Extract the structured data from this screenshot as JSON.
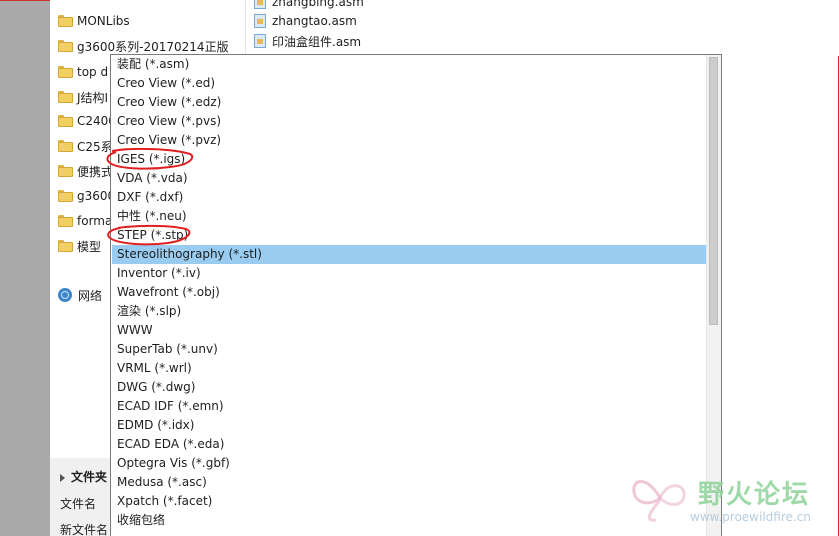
{
  "nav_pane": {
    "folders": [
      {
        "label": "MONLibs"
      },
      {
        "label": "g3600系列-20170214正版"
      },
      {
        "label": "top d"
      },
      {
        "label": "J结构I"
      },
      {
        "label": "C2400"
      },
      {
        "label": "C25系"
      },
      {
        "label": "便携式"
      },
      {
        "label": "g3600"
      },
      {
        "label": "forma"
      },
      {
        "label": "模型"
      }
    ],
    "network": {
      "label": "网络"
    }
  },
  "file_list": {
    "items": [
      {
        "name": "zhangbing.asm"
      },
      {
        "name": "zhangtao.asm"
      },
      {
        "name": "印油盒组件.asm"
      }
    ]
  },
  "bottom_form": {
    "folder_toggle_label": "文件夹",
    "file_name_label": "文件名",
    "new_file_name_label": "新文件名"
  },
  "type_dropdown": {
    "items": [
      {
        "label": "装配 (*.asm)"
      },
      {
        "label": "Creo View (*.ed)"
      },
      {
        "label": "Creo View (*.edz)"
      },
      {
        "label": "Creo View (*.pvs)"
      },
      {
        "label": "Creo View (*.pvz)"
      },
      {
        "label": "IGES (*.igs)"
      },
      {
        "label": "VDA (*.vda)"
      },
      {
        "label": "DXF (*.dxf)"
      },
      {
        "label": "中性 (*.neu)"
      },
      {
        "label": "STEP (*.stp)"
      },
      {
        "label": "Stereolithography (*.stl)"
      },
      {
        "label": "Inventor (*.iv)"
      },
      {
        "label": "Wavefront (*.obj)"
      },
      {
        "label": "渲染 (*.slp)"
      },
      {
        "label": "WWW"
      },
      {
        "label": "SuperTab (*.unv)"
      },
      {
        "label": "VRML (*.wrl)"
      },
      {
        "label": "DWG (*.dwg)"
      },
      {
        "label": "ECAD IDF (*.emn)"
      },
      {
        "label": "EDMD (*.idx)"
      },
      {
        "label": "ECAD EDA (*.eda)"
      },
      {
        "label": "Optegra Vis (*.gbf)"
      },
      {
        "label": "Medusa (*.asc)"
      },
      {
        "label": "Xpatch (*.facet)"
      },
      {
        "label": "收缩包络"
      }
    ],
    "selected_index": 10
  },
  "watermark": {
    "title": "野火论坛",
    "url": "www.proewildfire.cn"
  },
  "colors": {
    "selection": "#99ccf0",
    "annotation": "#e02020",
    "frame": "#a9a9a9"
  }
}
